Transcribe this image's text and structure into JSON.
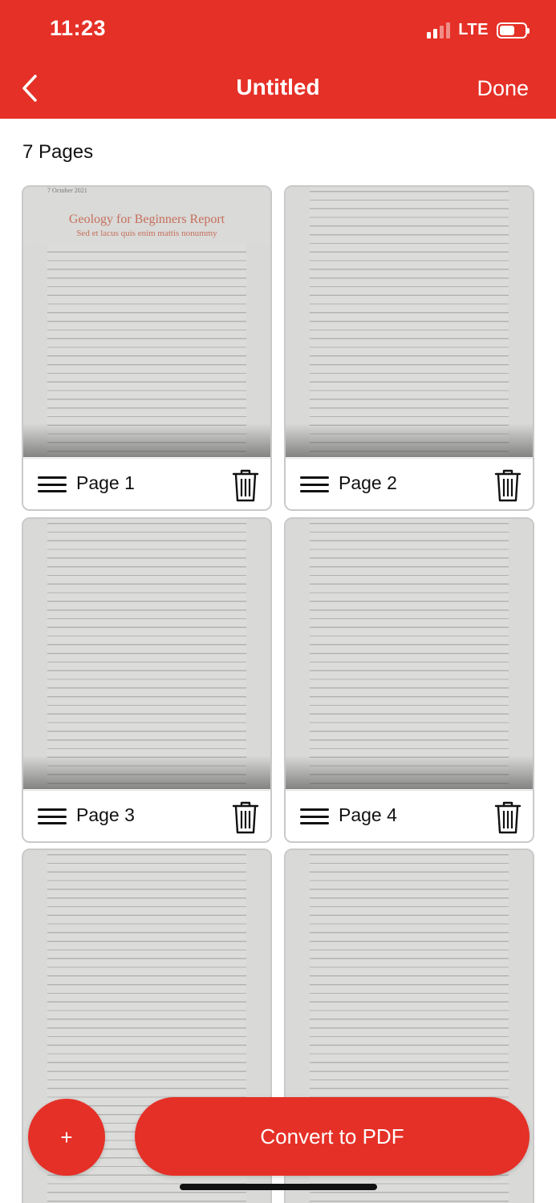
{
  "status_bar": {
    "time": "11:23",
    "network": "LTE",
    "signal_bars": 4,
    "signal_active": 2
  },
  "nav": {
    "title": "Untitled",
    "done_label": "Done",
    "back_icon": "chevron-left-icon"
  },
  "page_count_label": "7 Pages",
  "pages": [
    {
      "label": "Page 1",
      "date": "7 October 2021",
      "doc_title": "Geology for Beginners Report",
      "doc_subtitle": "Sed et lacus quis enim mattis nonummy"
    },
    {
      "label": "Page 2"
    },
    {
      "label": "Page 3"
    },
    {
      "label": "Page 4"
    },
    {
      "label": ""
    },
    {
      "label": ""
    }
  ],
  "actions": {
    "add_label": "+",
    "convert_label": "Convert to PDF"
  },
  "colors": {
    "accent": "#e53027",
    "card_border": "#c9c9c9",
    "text": "#111111"
  }
}
